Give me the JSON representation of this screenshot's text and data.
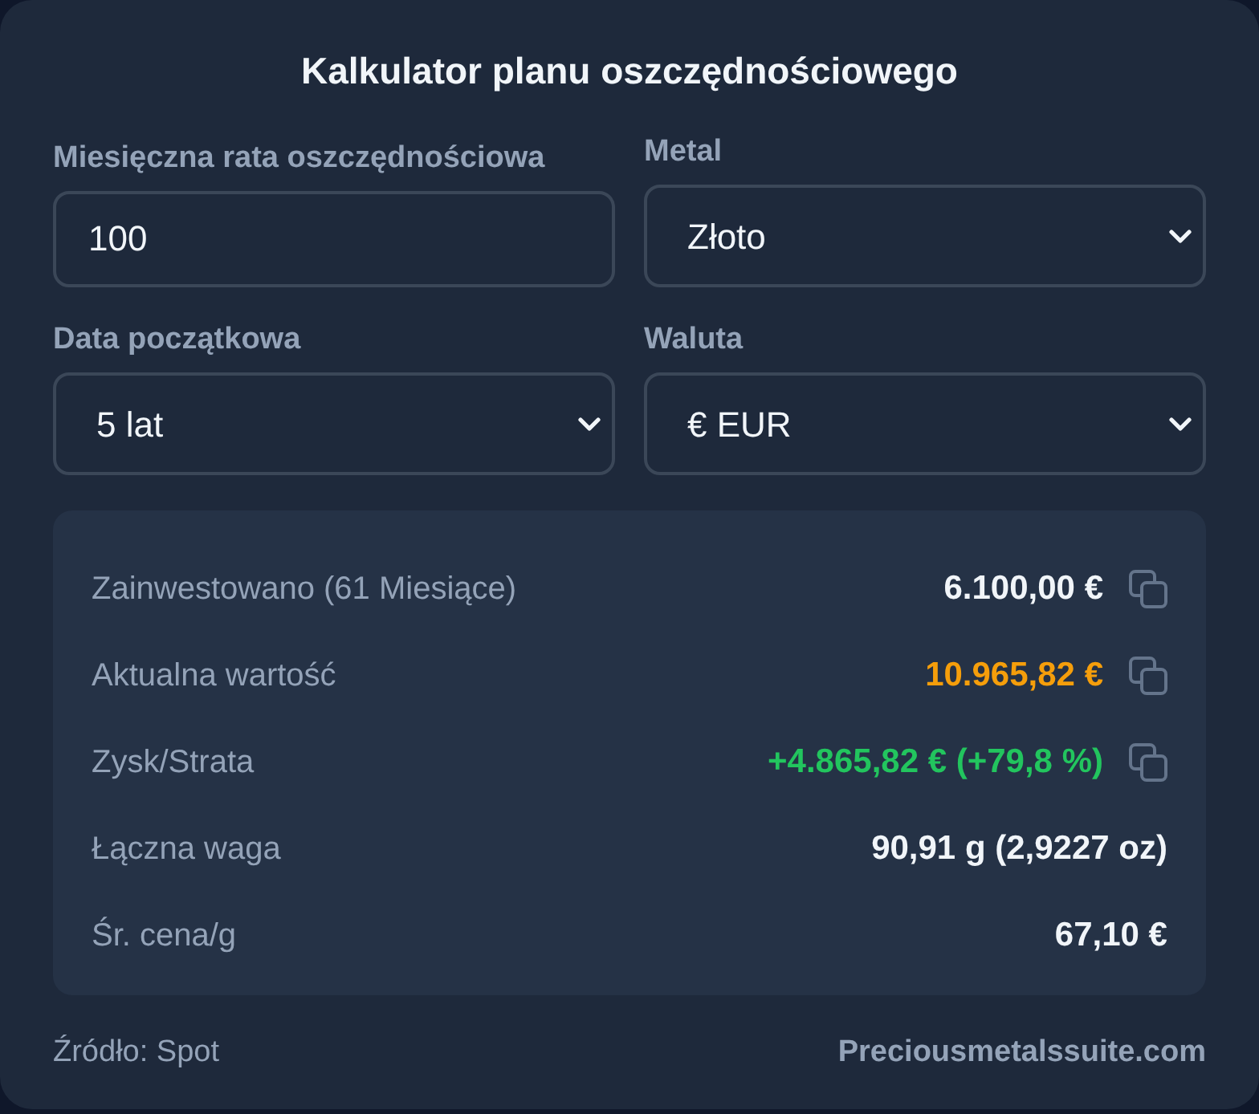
{
  "title": "Kalkulator planu oszczędnościowego",
  "fields": [
    {
      "kind": "input",
      "label": "Miesięczna rata oszczędnościowa",
      "value": "100"
    },
    {
      "kind": "select",
      "label": "Metal",
      "value": "Złoto"
    },
    {
      "kind": "select",
      "label": "Data początkowa",
      "value": "5 lat"
    },
    {
      "kind": "select",
      "label": "Waluta",
      "value": "€ EUR"
    }
  ],
  "results": [
    {
      "label": "Zainwestowano (61 Miesiące)",
      "value": "6.100,00 €",
      "color": "#f1f5f9",
      "copyable": true
    },
    {
      "label": "Aktualna wartość",
      "value": "10.965,82 €",
      "color": "#f59e0b",
      "copyable": true
    },
    {
      "label": "Zysk/Strata",
      "value": "+4.865,82 € (+79,8 %)",
      "color": "#22c55e",
      "copyable": true
    },
    {
      "label": "Łączna waga",
      "value": "90,91 g (2,9227 oz)",
      "color": "#f1f5f9",
      "copyable": false
    },
    {
      "label": "Śr. cena/g",
      "value": "67,10 €",
      "color": "#f1f5f9",
      "copyable": false
    }
  ],
  "footer": {
    "source": "Źródło: Spot",
    "site": "Preciousmetalssuite.com"
  }
}
